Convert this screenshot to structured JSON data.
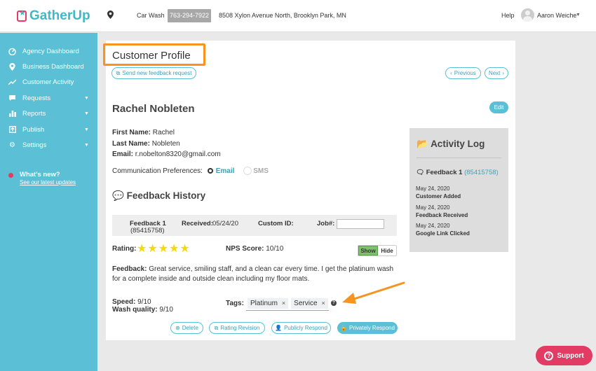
{
  "app": {
    "logo_text": "GatherUp"
  },
  "header": {
    "business_name": "Car Wash",
    "phone": "763-294-7922",
    "address": "8508 Xylon Avenue North, Brooklyn Park, MN",
    "help": "Help",
    "user_name": "Aaron Weiche"
  },
  "sidebar": {
    "items": [
      {
        "label": "Agency Dashboard",
        "icon": "dashboard-icon"
      },
      {
        "label": "Business Dashboard",
        "icon": "map-pin-icon"
      },
      {
        "label": "Customer Activity",
        "icon": "trend-icon"
      },
      {
        "label": "Requests",
        "icon": "comment-icon",
        "has_caret": true
      },
      {
        "label": "Reports",
        "icon": "bar-chart-icon",
        "has_caret": true
      },
      {
        "label": "Publish",
        "icon": "publish-icon",
        "has_caret": true
      },
      {
        "label": "Settings",
        "icon": "gear-icon",
        "has_caret": true
      }
    ],
    "whats_new": {
      "title": "What's new?",
      "link": "See our latest updates"
    }
  },
  "page": {
    "title": "Customer Profile",
    "send_request": "Send new feedback request",
    "previous": "Previous",
    "next": "Next"
  },
  "customer": {
    "name": "Rachel Nobleten",
    "edit": "Edit",
    "first_name_label": "First Name:",
    "first_name": "Rachel",
    "last_name_label": "Last Name:",
    "last_name": "Nobleten",
    "email_label": "Email:",
    "email": "r.nobelton8320@gmail.com",
    "comm_label": "Communication Preferences:",
    "comm_email": "Email",
    "comm_sms": "SMS"
  },
  "feedback_history": {
    "title": "Feedback History",
    "feedback_label": "Feedback 1",
    "feedback_id": "(85415758)",
    "received_label": "Received:",
    "received": "05/24/20",
    "custom_id_label": "Custom ID:",
    "job_label": "Job#:",
    "rating_label": "Rating:",
    "rating": 5,
    "rating_max": 5,
    "nps_label": "NPS Score:",
    "nps": "10/10",
    "show": "Show",
    "hide": "Hide",
    "feedback_label2": "Feedback:",
    "feedback_text": "Great service, smiling staff, and a clean car every time. I get the platinum wash for a complete inside and outside clean including my floor mats.",
    "speed_label": "Speed:",
    "speed": "9/10",
    "wash_label": "Wash quality:",
    "wash": "9/10",
    "tags_label": "Tags:",
    "tags": [
      "Platinum",
      "Service"
    ],
    "tag_remove": "×",
    "help_mark": "?",
    "actions": {
      "delete": "Delete",
      "rating_revision": "Rating Revision",
      "publicly": "Publicly Respond",
      "privately": "Privately Respond"
    }
  },
  "activity_log": {
    "title": "Activity Log",
    "feedback_label": "Feedback 1",
    "feedback_id": "(85415758)",
    "entries": [
      {
        "date": "May 24, 2020",
        "event": "Customer Added"
      },
      {
        "date": "May 24, 2020",
        "event": "Feedback Received"
      },
      {
        "date": "May 24, 2020",
        "event": "Google Link Clicked"
      }
    ]
  },
  "support": "Support",
  "colors": {
    "accent": "#5bc0d5",
    "brand_red": "#e23c64",
    "highlight": "#f7941d",
    "star": "#f5d90c"
  }
}
